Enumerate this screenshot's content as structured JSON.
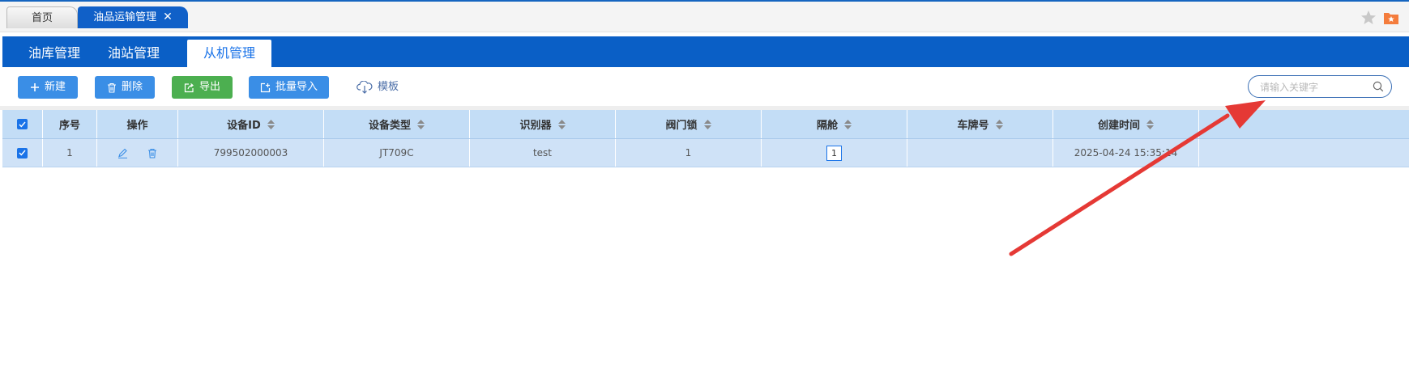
{
  "top_tabs": [
    {
      "label": "首页",
      "active": false
    },
    {
      "label": "油品运输管理",
      "active": true,
      "close": "✕"
    }
  ],
  "top_icons": [
    "star-icon",
    "folder-icon"
  ],
  "module_tabs": [
    {
      "label": "油库管理",
      "active": false
    },
    {
      "label": "油站管理",
      "active": false
    },
    {
      "label": "从机管理",
      "active": true
    }
  ],
  "toolbar": {
    "new_label": "新建",
    "delete_label": "删除",
    "export_label": "导出",
    "import_label": "批量导入",
    "template_label": "模板",
    "search_placeholder": "请输入关键字"
  },
  "table": {
    "columns": [
      "序号",
      "操作",
      "设备ID",
      "设备类型",
      "识别器",
      "阀门锁",
      "隔舱",
      "车牌号",
      "创建时间"
    ],
    "rows": [
      {
        "index": "1",
        "device_id": "799502000003",
        "device_type": "JT709C",
        "recognizer": "test",
        "valve_lock": "1",
        "compartment": "1",
        "plate": "",
        "created": "2025-04-24 15:35:14",
        "checked": true
      }
    ]
  },
  "colors": {
    "primary_blue": "#0a5fc6",
    "button_blue": "#3a8ee6",
    "button_green": "#4caf50",
    "header_row": "#c3ddf6",
    "selected_row": "#cfe2f7",
    "arrow": "#e53935"
  }
}
